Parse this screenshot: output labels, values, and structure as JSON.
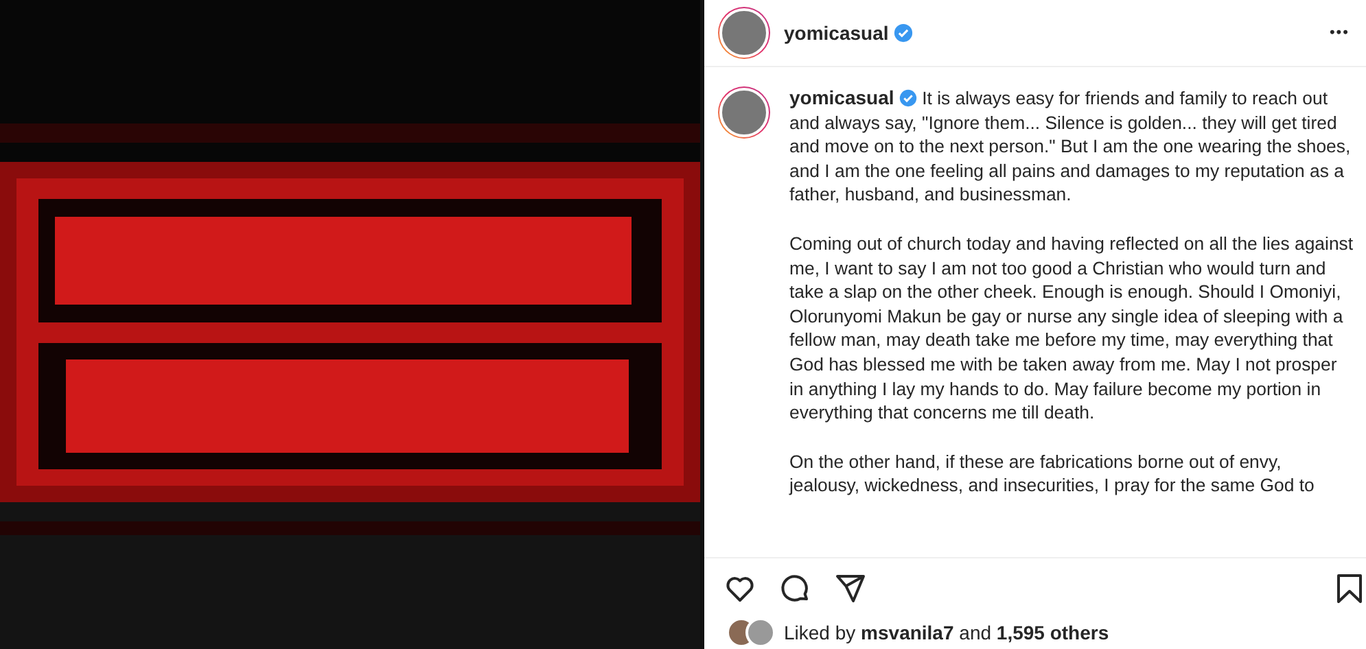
{
  "header": {
    "username": "yomicasual",
    "verified": true,
    "more": "•••"
  },
  "caption": {
    "username": "yomicasual",
    "verified": true,
    "paragraphs": [
      "It is always easy for friends and family to reach out and always say, \"Ignore them... Silence is golden... they will get tired and move on to the next person.\" But I am the one wearing the shoes, and I am the one feeling all pains and damages to my reputation as a father, husband, and businessman.",
      "Coming out of church today and having reflected on all the lies against me, I want to say I am not too good a Christian who would turn and take a slap on the other cheek. Enough is enough. Should I Omoniyi, Olorunyomi Makun be gay or nurse any single idea of sleeping with a fellow man, may death take me before my time, may everything that God has blessed me with be taken away from me. May I not prosper in anything I lay my hands to do. May failure become my portion in everything that concerns me till death.",
      "On the other hand, if these are fabrications borne out of envy, jealousy, wickedness, and insecurities, I pray for the same God to"
    ]
  },
  "actions": {
    "liked": false,
    "saved": false
  },
  "likes": {
    "text": "Liked by **msvanila7** and **1,595 others**"
  }
}
